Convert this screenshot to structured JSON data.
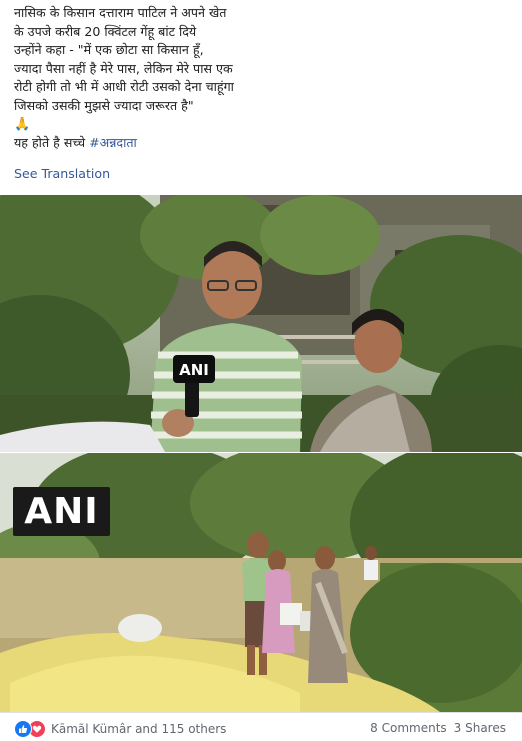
{
  "post": {
    "lines": [
      "नासिक के किसान दत्ताराम पाटिल ने अपने खेत",
      "के उपजे करीब 20 क्विंटल गेंहू बांट दिये",
      "उन्होंने कहा - \"में एक छोटा सा किसान हूँ,",
      "ज्यादा पैसा नहीं है मेरे पास, लेकिन मेरे पास एक",
      "रोटी होगी तो भी में आधी रोटी उसको देना चाहूंगा",
      "जिसको उसकी मुझसे ज्यादा जरूरत है\""
    ],
    "emoji": "🙏",
    "closing_text": "यह होते है सच्चे ",
    "hashtag": "#अन्नदाता",
    "see_translation": "See Translation"
  },
  "photos": {
    "mic_label": "ANI",
    "watermark": "ANI"
  },
  "footer": {
    "reactors": "Kāmãl Kümâr and 115 others",
    "comments": "8 Comments",
    "shares": "3 Shares"
  },
  "icons": {
    "like": "like-icon",
    "love": "love-icon",
    "pray": "folded-hands-emoji"
  },
  "colors": {
    "link": "#365899",
    "like_blue": "#1877f2",
    "love_red": "#f33e58",
    "meta_gray": "#606770"
  }
}
